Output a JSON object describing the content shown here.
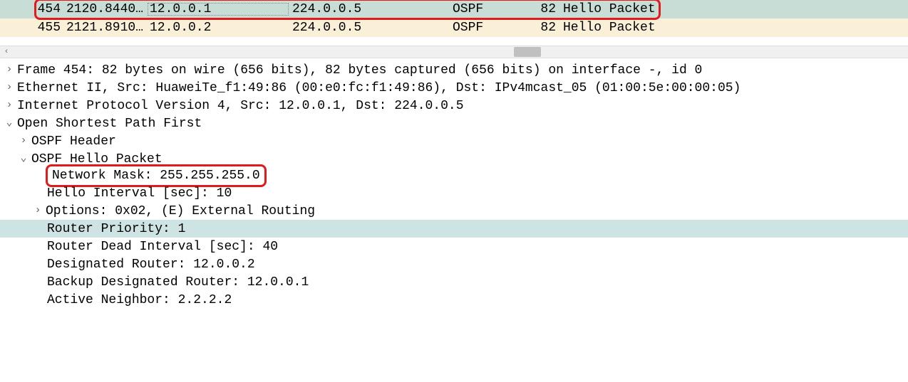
{
  "packet_list": {
    "rows": [
      {
        "no": "454",
        "time": "2120.8440…",
        "src": "12.0.0.1",
        "dst": "224.0.0.5",
        "proto": "OSPF",
        "len": "82",
        "info": "Hello Packet"
      },
      {
        "no": "455",
        "time": "2121.8910…",
        "src": "12.0.0.2",
        "dst": "224.0.0.5",
        "proto": "OSPF",
        "len": "82",
        "info": "Hello Packet"
      }
    ]
  },
  "details": {
    "frame": "Frame 454: 82 bytes on wire (656 bits), 82 bytes captured (656 bits) on interface -, id 0",
    "eth": "Ethernet II, Src: HuaweiTe_f1:49:86 (00:e0:fc:f1:49:86), Dst: IPv4mcast_05 (01:00:5e:00:00:05)",
    "ip": "Internet Protocol Version 4, Src: 12.0.0.1, Dst: 224.0.0.5",
    "ospf_root": "Open Shortest Path First",
    "ospf_header": "OSPF Header",
    "ospf_hello": "OSPF Hello Packet",
    "hello_fields": {
      "netmask": "Network Mask: 255.255.255.0",
      "hello_interval": "Hello Interval [sec]: 10",
      "options": "Options: 0x02, (E) External Routing",
      "router_priority": "Router Priority: 1",
      "dead_interval": "Router Dead Interval [sec]: 40",
      "dr": "Designated Router: 12.0.0.2",
      "bdr": "Backup Designated Router: 12.0.0.1",
      "neighbor": "Active Neighbor: 2.2.2.2"
    }
  }
}
